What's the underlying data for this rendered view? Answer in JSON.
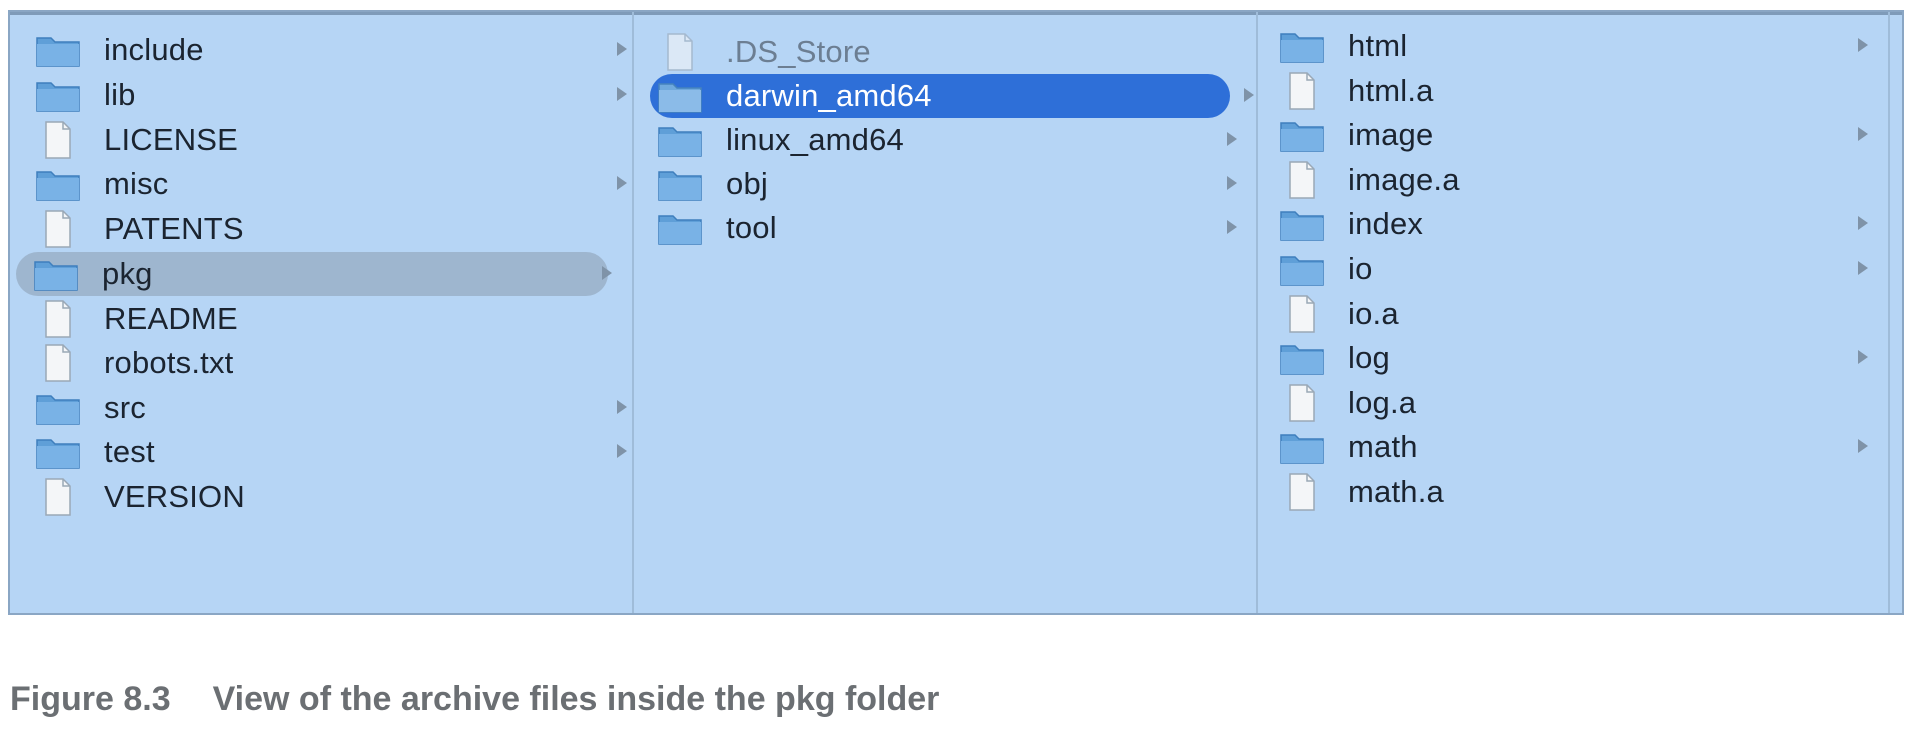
{
  "columns": [
    {
      "items": [
        {
          "label": "include",
          "type": "folder",
          "has_children": true
        },
        {
          "label": "lib",
          "type": "folder",
          "has_children": true
        },
        {
          "label": "LICENSE",
          "type": "file",
          "has_children": false
        },
        {
          "label": "misc",
          "type": "folder",
          "has_children": true
        },
        {
          "label": "PATENTS",
          "type": "file",
          "has_children": false
        },
        {
          "label": "pkg",
          "type": "folder",
          "has_children": true,
          "selected": "inactive"
        },
        {
          "label": "README",
          "type": "file",
          "has_children": false
        },
        {
          "label": "robots.txt",
          "type": "file",
          "has_children": false
        },
        {
          "label": "src",
          "type": "folder",
          "has_children": true
        },
        {
          "label": "test",
          "type": "folder",
          "has_children": true
        },
        {
          "label": "VERSION",
          "type": "file",
          "has_children": false
        }
      ]
    },
    {
      "items": [
        {
          "label": ".DS_Store",
          "type": "file",
          "has_children": false,
          "dimmed": true
        },
        {
          "label": "darwin_amd64",
          "type": "folder",
          "has_children": true,
          "selected": "active"
        },
        {
          "label": "linux_amd64",
          "type": "folder",
          "has_children": true
        },
        {
          "label": "obj",
          "type": "folder",
          "has_children": true
        },
        {
          "label": "tool",
          "type": "folder",
          "has_children": true
        }
      ]
    },
    {
      "items": [
        {
          "label": "html",
          "type": "folder",
          "has_children": true
        },
        {
          "label": "html.a",
          "type": "file",
          "has_children": false
        },
        {
          "label": "image",
          "type": "folder",
          "has_children": true
        },
        {
          "label": "image.a",
          "type": "file",
          "has_children": false
        },
        {
          "label": "index",
          "type": "folder",
          "has_children": true
        },
        {
          "label": "io",
          "type": "folder",
          "has_children": true
        },
        {
          "label": "io.a",
          "type": "file",
          "has_children": false
        },
        {
          "label": "log",
          "type": "folder",
          "has_children": true
        },
        {
          "label": "log.a",
          "type": "file",
          "has_children": false
        },
        {
          "label": "math",
          "type": "folder",
          "has_children": true
        },
        {
          "label": "math.a",
          "type": "file",
          "has_children": false
        }
      ]
    }
  ],
  "caption": {
    "number": "Figure 8.3",
    "text": "View of the archive files inside the pkg folder"
  },
  "colors": {
    "background": "#b6d5f5",
    "selection_active": "#2e6fd8",
    "selection_inactive": "#9eb6cf",
    "folder_icon": "#5f9fd8"
  },
  "icons": {
    "folder": "folder-icon",
    "file": "document-icon",
    "disclosure": "disclosure-arrow-icon"
  }
}
